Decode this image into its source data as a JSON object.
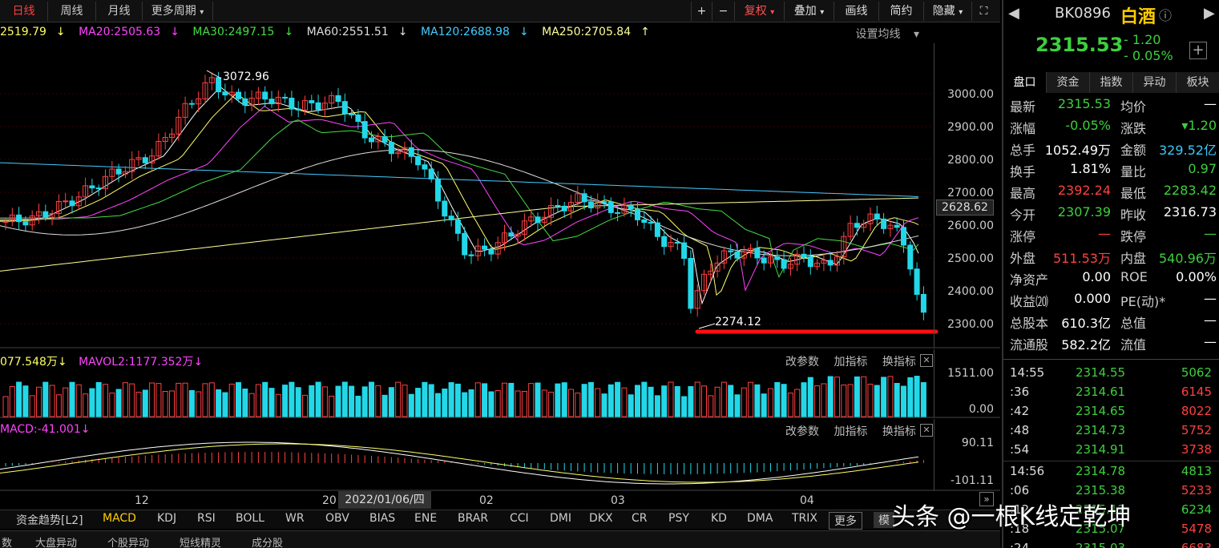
{
  "periods": [
    "日线",
    "周线",
    "月线",
    "更多周期"
  ],
  "right_tools": {
    "plus": "+",
    "minus": "−",
    "fuquan": "复权",
    "diejia": "叠加",
    "huaxian": "画线",
    "jianyue": "简约",
    "yincang": "隐藏"
  },
  "ma": {
    "ma10": "2519.79",
    "ma20": "MA20:2505.63",
    "ma30": "MA30:2497.15",
    "ma60": "MA60:2551.51",
    "ma120": "MA120:2688.98",
    "ma250": "MA250:2705.84",
    "settings": "设置均线"
  },
  "price_axis": [
    "3000.00",
    "2900.00",
    "2800.00",
    "2700.00",
    "2600.00",
    "2500.00",
    "2400.00",
    "2300.00"
  ],
  "current_price_tag": "2628.62",
  "high_annotation": "3072.96",
  "low_annotation": "2274.12",
  "vol": {
    "mavol1": "077.548万",
    "mavol2": "MAVOL2:1177.352万",
    "axis_top": "1511.00",
    "axis_bottom": "0.00"
  },
  "macd": {
    "label": "MACD:-41.001",
    "axis_top": "90.11",
    "axis_bottom": "-101.11"
  },
  "panel_tools": {
    "gaicanshu": "改参数",
    "jiazhibiao": "加指标",
    "huanzhibiao": "换指标",
    "close": "✕"
  },
  "x_axis": [
    "12",
    "20",
    "02",
    "03",
    "04"
  ],
  "date_tooltip": "2022/01/06/四",
  "indicators": [
    "资金趋势[L2]",
    "MACD",
    "KDJ",
    "RSI",
    "BOLL",
    "WR",
    "OBV",
    "BIAS",
    "ENE",
    "BRAR",
    "CCI",
    "DMI",
    "DKX",
    "CR",
    "PSY",
    "KD",
    "DMA",
    "TRIX"
  ],
  "more_label": "更多",
  "mode_label": "模",
  "bottom_tabs": [
    "数",
    "大盘异动",
    "个股异动",
    "短线精灵",
    "成分股"
  ],
  "stock": {
    "code": "BK0896",
    "name": "白酒",
    "price": "2315.53",
    "change": "- 1.20",
    "change_pct": "- 0.05%"
  },
  "right_tabs": [
    "盘口",
    "资金",
    "指数",
    "异动",
    "板块"
  ],
  "stats": [
    {
      "l1": "最新",
      "v1": "2315.53",
      "c1": "green",
      "l2": "均价",
      "v2": "—",
      "c2": "white"
    },
    {
      "l1": "涨幅",
      "v1": "-0.05%",
      "c1": "green",
      "l2": "涨跌",
      "v2": "▾1.20",
      "c2": "green"
    },
    {
      "l1": "总手",
      "v1": "1052.49万",
      "c1": "white",
      "l2": "金额",
      "v2": "329.52亿",
      "c2": "cyan"
    },
    {
      "l1": "换手",
      "v1": "1.81%",
      "c1": "white",
      "l2": "量比",
      "v2": "0.97",
      "c2": "green"
    },
    {
      "l1": "最高",
      "v1": "2392.24",
      "c1": "red",
      "l2": "最低",
      "v2": "2283.42",
      "c2": "green"
    },
    {
      "l1": "今开",
      "v1": "2307.39",
      "c1": "green",
      "l2": "昨收",
      "v2": "2316.73",
      "c2": "white"
    },
    {
      "l1": "涨停",
      "v1": "—",
      "c1": "red",
      "l2": "跌停",
      "v2": "—",
      "c2": "green"
    },
    {
      "l1": "外盘",
      "v1": "511.53万",
      "c1": "red",
      "l2": "内盘",
      "v2": "540.96万",
      "c2": "green"
    },
    {
      "l1": "净资产",
      "v1": "0.00",
      "c1": "white",
      "l2": "ROE",
      "v2": "0.00%",
      "c2": "white"
    },
    {
      "l1": "收益⒇",
      "v1": "0.000",
      "c1": "white",
      "l2": "PE(动)*",
      "v2": "—",
      "c2": "white"
    },
    {
      "l1": "总股本",
      "v1": "610.3亿",
      "c1": "white",
      "l2": "总值",
      "v2": "—",
      "c2": "white"
    },
    {
      "l1": "流通股",
      "v1": "582.2亿",
      "c1": "white",
      "l2": "流值",
      "v2": "—",
      "c2": "white"
    }
  ],
  "ticks": [
    {
      "t": "14:55",
      "p": "2314.55",
      "v": "5062",
      "c": "green"
    },
    {
      "t": ":36",
      "p": "2314.61",
      "v": "6145",
      "c": "red"
    },
    {
      "t": ":42",
      "p": "2314.65",
      "v": "8022",
      "c": "red"
    },
    {
      "t": ":48",
      "p": "2314.73",
      "v": "5752",
      "c": "red"
    },
    {
      "t": ":54",
      "p": "2314.91",
      "v": "3738",
      "c": "red"
    },
    {
      "t": "14:56",
      "p": "2314.78",
      "v": "4813",
      "c": "green"
    },
    {
      "t": ":06",
      "p": "2315.38",
      "v": "5233",
      "c": "red"
    },
    {
      "t": ":12",
      "p": "2315.12",
      "v": "6234",
      "c": "green"
    },
    {
      "t": ":18",
      "p": "2315.07",
      "v": "5478",
      "c": "red"
    },
    {
      "t": ":24",
      "p": "2315.03",
      "v": "6683",
      "c": "red"
    }
  ],
  "watermark": "头条 @一根K线定乾坤",
  "colors": {
    "up": "#ff4040",
    "down": "#22d8e8",
    "ma5": "#ffffff",
    "ma10": "#ffff66",
    "ma20": "#ff44ff",
    "ma30": "#44dd44",
    "ma60": "#dddddd",
    "ma120": "#44ccff",
    "ma250": "#ffff99"
  }
}
